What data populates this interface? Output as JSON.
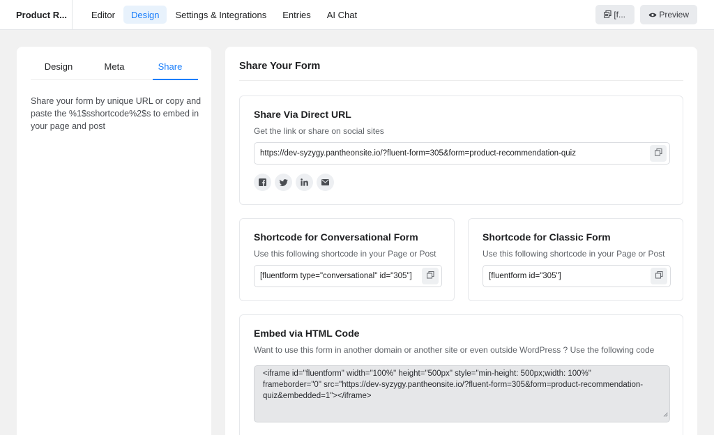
{
  "header": {
    "form_title": "Product R...",
    "nav": [
      {
        "label": "Editor",
        "active": false
      },
      {
        "label": "Design",
        "active": true
      },
      {
        "label": "Settings & Integrations",
        "active": false
      },
      {
        "label": "Entries",
        "active": false
      },
      {
        "label": "AI Chat",
        "active": false
      }
    ],
    "copy_shortcode_label": "[f...",
    "preview_label": "Preview",
    "copy_icon": "copy-icon",
    "preview_icon": "eye-icon"
  },
  "sidebar": {
    "tabs": [
      {
        "label": "Design",
        "active": false
      },
      {
        "label": "Meta",
        "active": false
      },
      {
        "label": "Share",
        "active": true
      }
    ],
    "description": "Share your form by unique URL or copy and paste the %1$sshortcode%2$s to embed in your page and post"
  },
  "main": {
    "title": "Share Your Form",
    "direct_url": {
      "title": "Share Via Direct URL",
      "subtitle": "Get the link or share on social sites",
      "url": "https://dev-syzygy.pantheonsite.io/?fluent-form=305&form=product-recommendation-quiz",
      "social": [
        "facebook-icon",
        "twitter-icon",
        "linkedin-icon",
        "email-icon"
      ]
    },
    "conversational": {
      "title": "Shortcode for Conversational Form",
      "subtitle": "Use this following shortcode in your Page or Post",
      "shortcode": "[fluentform type=\"conversational\" id=\"305\"]"
    },
    "classic": {
      "title": "Shortcode for Classic Form",
      "subtitle": "Use this following shortcode in your Page or Post",
      "shortcode": "[fluentform id=\"305\"]"
    },
    "embed": {
      "title": "Embed via HTML Code",
      "subtitle": "Want to use this form in another domain or another site or even outside WordPress ? Use the following code",
      "code_lines": [
        "<iframe id=\"fluentform\" width=\"100%\" height=\"500px\" style=\"min-height: 500px;width: 100%\"",
        "frameborder=\"0\" src=\"https://dev-syzygy.pantheonsite.io/?fluent-form=305&form=product-recommendation-",
        "quiz&embedded=1\"></iframe>"
      ]
    }
  },
  "colors": {
    "accent": "#1a7efb",
    "background": "#f1f1f1",
    "code_bg": "#e6e7e9"
  }
}
